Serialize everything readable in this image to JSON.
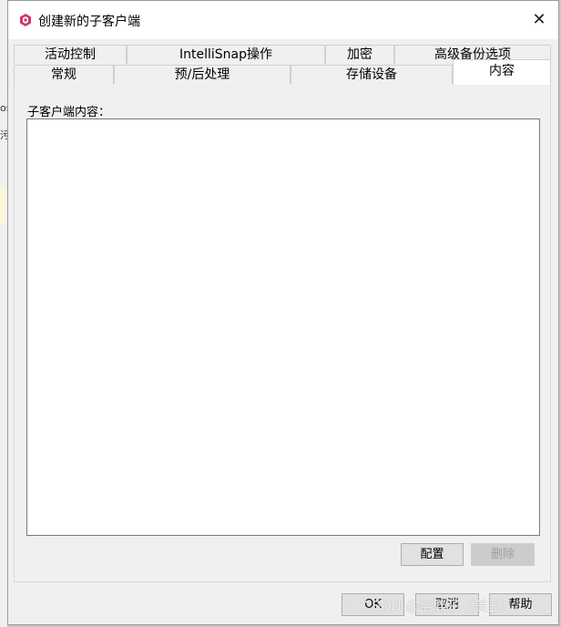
{
  "window": {
    "title": "创建新的子客户端",
    "close_glyph": "✕"
  },
  "background": {
    "fragment_1": "os",
    "fragment_2": "污"
  },
  "tabs_back_row": [
    {
      "label": "活动控制"
    },
    {
      "label": "IntelliSnap操作"
    },
    {
      "label": "加密"
    },
    {
      "label": "高级备份选项"
    }
  ],
  "tabs_front_row": [
    {
      "label": "常规"
    },
    {
      "label": "预/后处理"
    },
    {
      "label": "存储设备"
    },
    {
      "label": "内容",
      "active": true
    }
  ],
  "content": {
    "label": "子客户端内容：",
    "items": []
  },
  "panel_buttons": {
    "configure": "配置",
    "delete": "删除"
  },
  "footer_buttons": {
    "ok": "OK",
    "cancel": "取消",
    "help": "帮助"
  },
  "watermark": "CSDN @盐胖子（美丑）",
  "colors": {
    "app_icon": "#d6336c",
    "active_tab": "#ffffff",
    "dialog_bg": "#f0f0f0"
  }
}
